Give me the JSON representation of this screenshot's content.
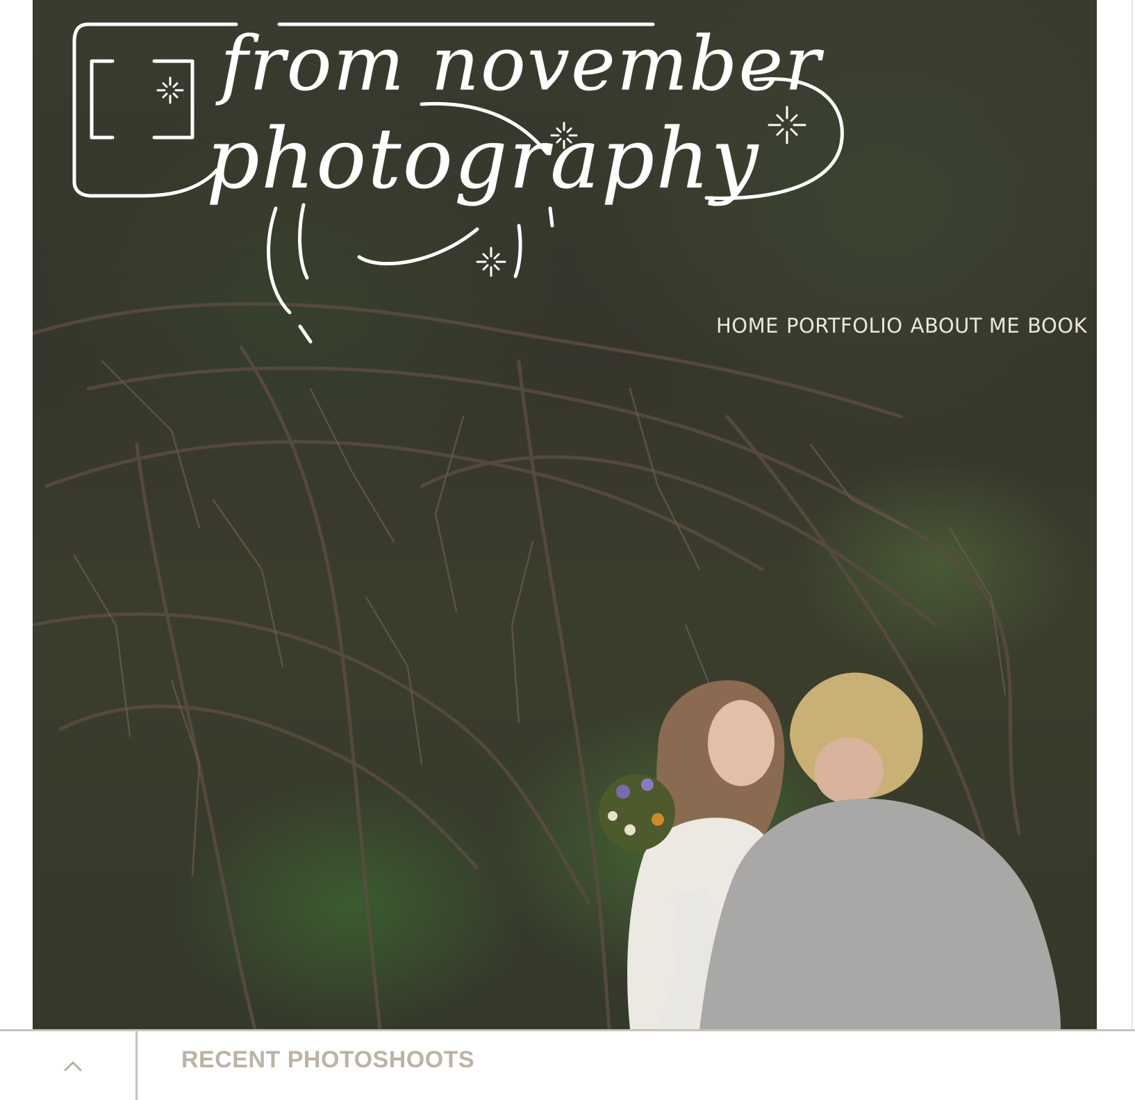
{
  "logo": {
    "line1": "from november",
    "line2": "photography"
  },
  "nav": {
    "items": [
      {
        "label": "HOME"
      },
      {
        "label": "PORTFOLIO"
      },
      {
        "label": "ABOUT ME"
      },
      {
        "label": "BOOK"
      }
    ]
  },
  "hero": {
    "icons": {
      "camera": "camera-icon",
      "sparkle": "sparkle-icon"
    }
  },
  "footer": {
    "scroll_icon": "chevron-up-icon",
    "section_title": "RECENT PHOTOSHOOTS"
  },
  "colors": {
    "nav_text": "#ece6de",
    "section_title": "#bcb3a6",
    "divider": "#c8c2b6"
  }
}
